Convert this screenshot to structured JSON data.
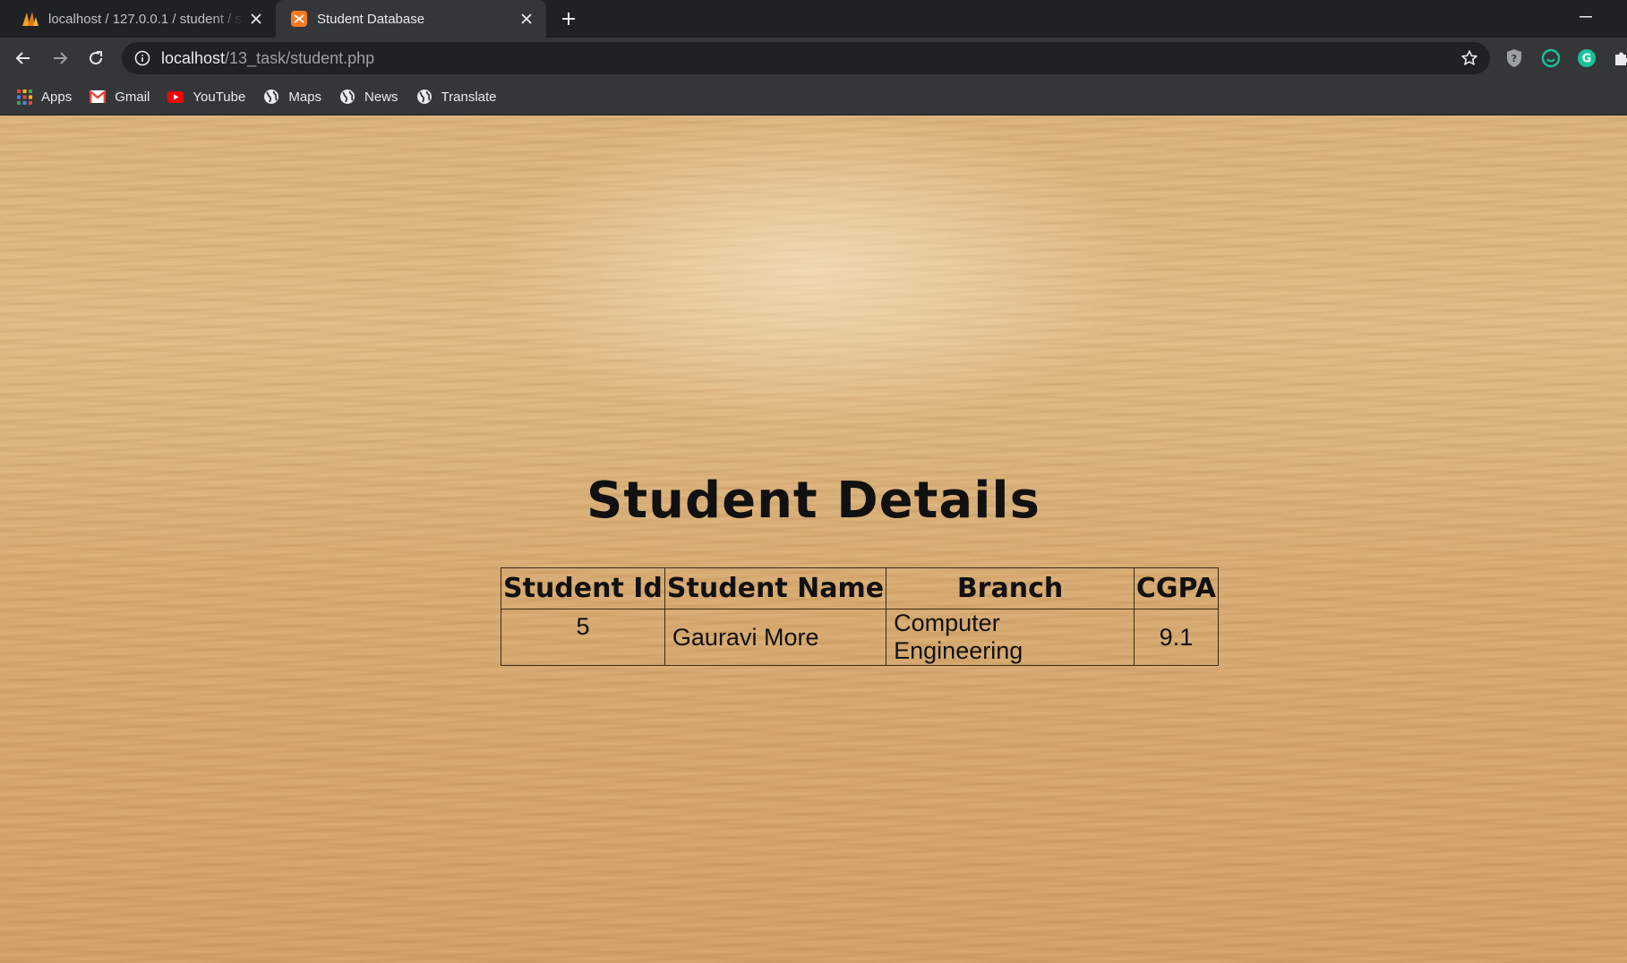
{
  "browser": {
    "tabs": [
      {
        "title": "localhost / 127.0.0.1 / student / st",
        "active": false,
        "icon": "phpmyadmin-icon"
      },
      {
        "title": "Student Database",
        "active": true,
        "icon": "xampp-icon"
      }
    ],
    "url_host": "localhost",
    "url_path": "/13_task/student.php",
    "bookmarks": [
      {
        "label": "Apps",
        "icon": "apps-grid-icon"
      },
      {
        "label": "Gmail",
        "icon": "gmail-icon"
      },
      {
        "label": "YouTube",
        "icon": "youtube-icon"
      },
      {
        "label": "Maps",
        "icon": "globe-icon"
      },
      {
        "label": "News",
        "icon": "globe-icon"
      },
      {
        "label": "Translate",
        "icon": "globe-icon"
      }
    ],
    "colors": {
      "chrome_dark": "#202124",
      "chrome_toolbar": "#35363a",
      "accent_green": "#15c39a"
    }
  },
  "page": {
    "heading": "Student Details",
    "table": {
      "headers": [
        "Student Id",
        "Student Name",
        "Branch",
        "CGPA"
      ],
      "rows": [
        [
          "5",
          "Gauravi More",
          "Computer Engineering",
          "9.1"
        ]
      ]
    }
  }
}
